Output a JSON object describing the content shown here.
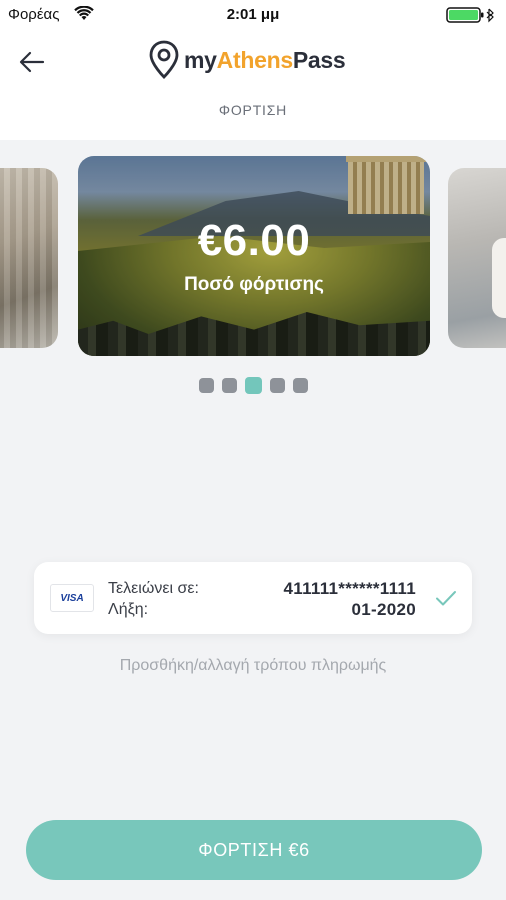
{
  "status_bar": {
    "carrier": "Φορέας",
    "time": "2:01 μμ"
  },
  "header": {
    "logo": {
      "my": "my",
      "athens": "Athens",
      "pass": "Pass"
    },
    "title": "ΦΟΡΤΙΣΗ",
    "back_icon": "arrow-left-icon"
  },
  "carousel": {
    "amount": "€6.00",
    "label": "Ποσό φόρτισης",
    "dots_count": 5,
    "active_index": 2
  },
  "payment": {
    "card_brand": "VISA",
    "label_ends": "Τελειώνει σε:",
    "label_expiry": "Λήξη:",
    "card_number": "411111******1111",
    "expiry": "01-2020",
    "selected_icon": "check-icon"
  },
  "add_payment_link": "Προσθήκη/αλλαγή τρόπου πληρωμής",
  "charge_button": "ΦΟΡΤΙΣΗ €6",
  "colors": {
    "accent": "#78c7bb",
    "logo_orange": "#f2a32c",
    "text_dark": "#2b2f3a",
    "background": "#f2f3f5"
  }
}
